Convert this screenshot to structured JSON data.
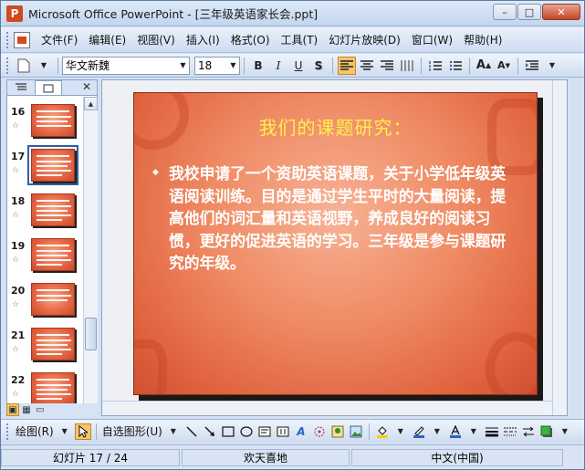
{
  "window": {
    "title": "Microsoft Office PowerPoint - [三年级英语家长会.ppt]",
    "app_icon": "P",
    "buttons": {
      "minimize": "–",
      "maximize": "□",
      "close": "✕"
    }
  },
  "menubar": {
    "items": [
      "文件(F)",
      "编辑(E)",
      "视图(V)",
      "插入(I)",
      "格式(O)",
      "工具(T)",
      "幻灯片放映(D)",
      "窗口(W)",
      "帮助(H)"
    ]
  },
  "toolbar": {
    "font_name": "华文新魏",
    "font_size": "18",
    "bold": "B",
    "italic": "I",
    "underline": "U",
    "shadow": "S",
    "font_up": "A",
    "font_down": "A",
    "active_align": "align-left"
  },
  "left_pane": {
    "tab_outline_icon": "outline-icon",
    "tab_slides_icon": "slides-icon",
    "close": "✕",
    "slides": [
      {
        "number": "16",
        "lines": 4,
        "selected": false
      },
      {
        "number": "17",
        "lines": 5,
        "selected": true
      },
      {
        "number": "18",
        "lines": 5,
        "selected": false
      },
      {
        "number": "19",
        "lines": 5,
        "selected": false
      },
      {
        "number": "20",
        "lines": 3,
        "selected": false
      },
      {
        "number": "21",
        "lines": 5,
        "selected": false
      },
      {
        "number": "22",
        "lines": 5,
        "selected": false
      }
    ],
    "star": "☆"
  },
  "slide": {
    "title": "我们的课题研究：",
    "bullet": "◆",
    "body": "我校申请了一个资助英语课题，关于小学低年级英语阅读训练。目的是通过学生平时的大量阅读，提高他们的词汇量和英语视野，养成良好的阅读习惯，更好的促进英语的学习。三年级是参与课题研究的年级。",
    "colors": {
      "title": "#fff04a",
      "body": "#ffffff",
      "background": "#ef8a63"
    }
  },
  "drawbar": {
    "draw_label": "绘图(R)",
    "autoshapes_label": "自选图形(U)"
  },
  "statusbar": {
    "slide_info": "幻灯片 17 / 24",
    "design": "欢天喜地",
    "language": "中文(中国)"
  }
}
